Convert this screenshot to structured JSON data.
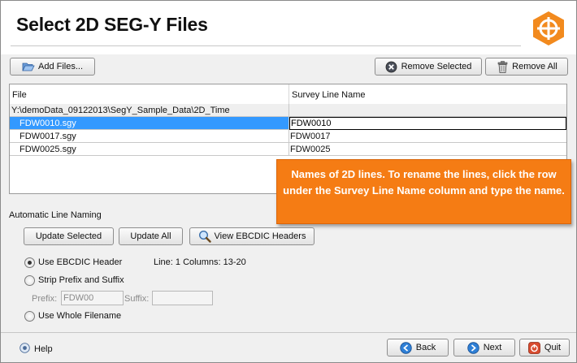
{
  "window": {
    "title": "Select 2D SEG-Y Files"
  },
  "toolbar": {
    "add_files_label": "Add Files...",
    "remove_selected_label": "Remove Selected",
    "remove_all_label": "Remove All"
  },
  "table": {
    "columns": [
      "File",
      "Survey Line Name"
    ],
    "group_path": "Y:\\demoData_09122013\\SegY_Sample_Data\\2D_Time",
    "rows": [
      {
        "file": "FDW0010.sgy",
        "survey": "FDW0010",
        "selected": true
      },
      {
        "file": "FDW0017.sgy",
        "survey": "FDW0017",
        "selected": false
      },
      {
        "file": "FDW0025.sgy",
        "survey": "FDW0025",
        "selected": false
      }
    ]
  },
  "callout": {
    "text": "Names of 2D lines. To rename the lines, click the row under the Survey Line Name column and type the name."
  },
  "naming": {
    "section_label": "Automatic Line Naming",
    "update_selected_label": "Update Selected",
    "update_all_label": "Update All",
    "view_ebcdic_label": "View EBCDIC Headers",
    "option_ebcdic_label": "Use EBCDIC Header",
    "ebcdic_info": "Line: 1 Columns: 13-20",
    "option_strip_label": "Strip Prefix and Suffix",
    "prefix_label": "Prefix:",
    "prefix_value": "FDW00",
    "suffix_label": "Suffix:",
    "suffix_value": "",
    "option_whole_label": "Use Whole Filename",
    "selected_option": "ebcdic"
  },
  "footer": {
    "help_label": "Help",
    "back_label": "Back",
    "next_label": "Next",
    "quit_label": "Quit"
  },
  "colors": {
    "accent_orange": "#f57c14",
    "selection_blue": "#3399ff"
  },
  "icons": {
    "logo": "crosshair-hexagon-logo",
    "add_files": "folder-open-icon",
    "remove_selected": "remove-circle-icon",
    "remove_all": "trash-can-icon",
    "view_ebcdic": "magnifier-icon",
    "help": "help-icon",
    "back": "arrow-left-circle-icon",
    "next": "arrow-right-circle-icon",
    "quit": "power-icon"
  }
}
